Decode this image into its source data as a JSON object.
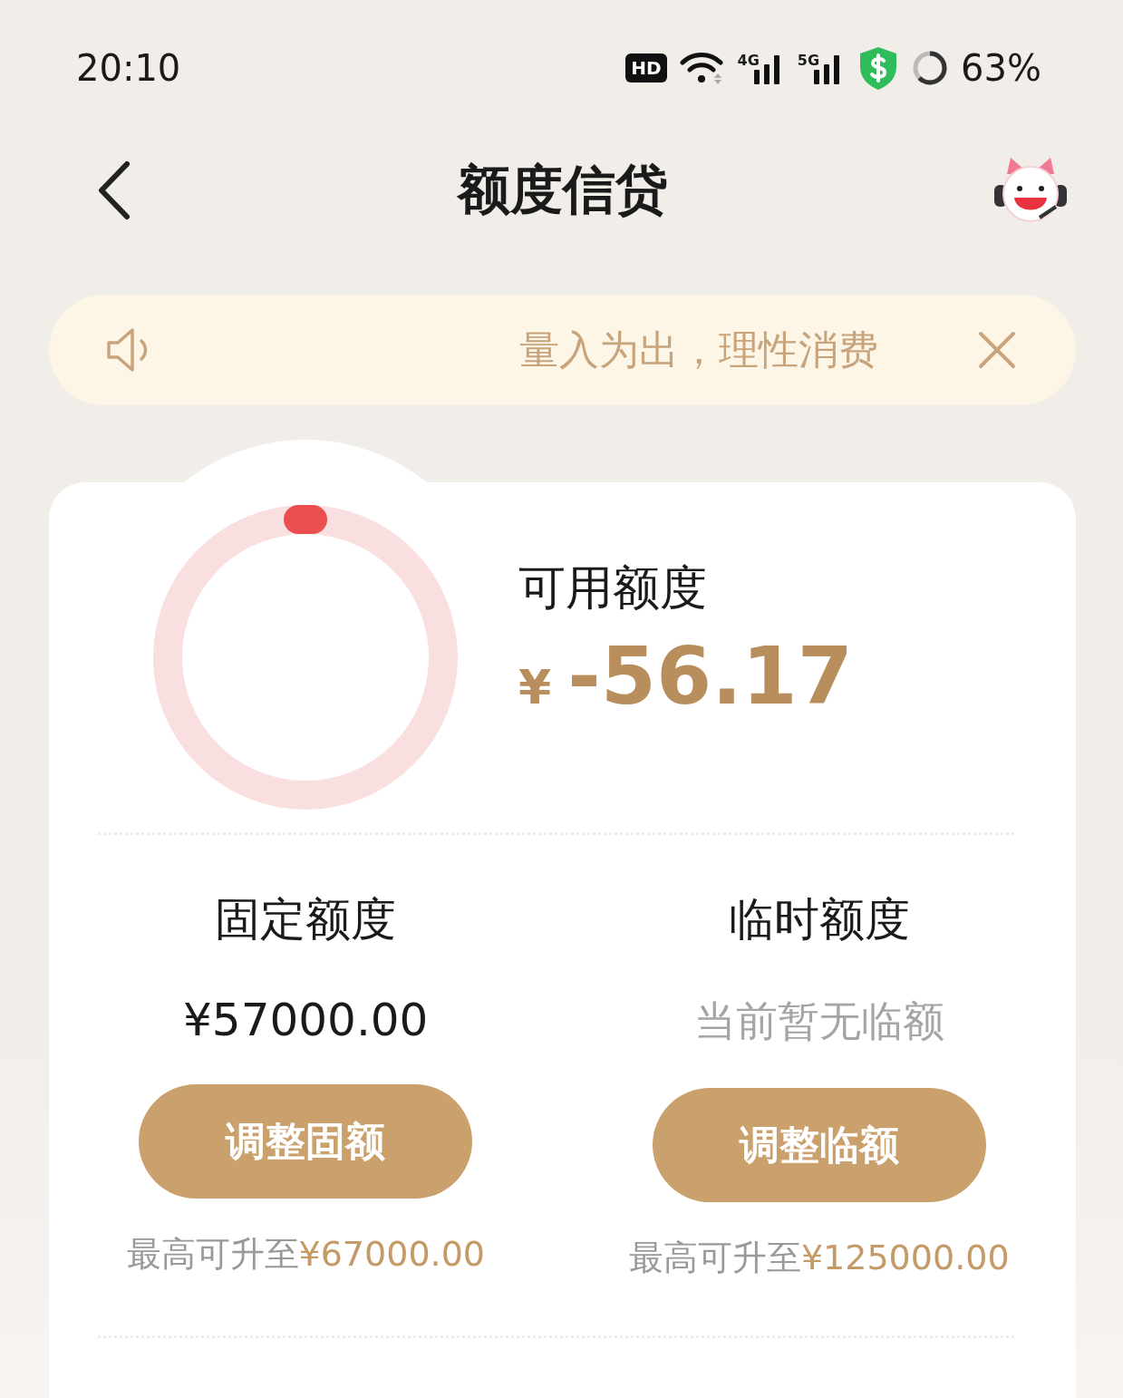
{
  "status_bar": {
    "time": "20:10",
    "hd_badge": "HD",
    "networks": [
      {
        "label": "4G"
      },
      {
        "label": "5G"
      }
    ],
    "battery": "63%"
  },
  "header": {
    "title": "额度信贷"
  },
  "notice": {
    "text": "量入为出，理性消费"
  },
  "available": {
    "label": "可用额度",
    "currency": "¥",
    "amount": "-56.17"
  },
  "columns": [
    {
      "title": "固定额度",
      "value": "¥57000.00",
      "muted": false,
      "button": "调整固额",
      "note_label": "最高可升至",
      "note_amount": "¥67000.00"
    },
    {
      "title": "临时额度",
      "value": "当前暂无临额",
      "muted": true,
      "button": "调整临额",
      "note_label": "最高可升至",
      "note_amount": "¥125000.00"
    }
  ]
}
